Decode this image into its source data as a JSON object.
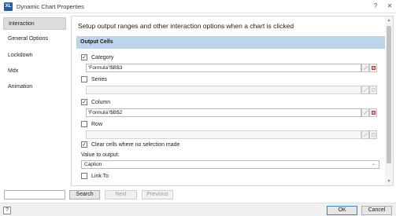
{
  "window": {
    "app_icon_text": "XL",
    "title": "Dynamic Chart Properties",
    "help_glyph": "?",
    "close_glyph": "✕"
  },
  "sidebar": {
    "items": [
      {
        "label": "Interaction",
        "active": true
      },
      {
        "label": "General Options",
        "active": false
      },
      {
        "label": "Lockdown",
        "active": false
      },
      {
        "label": "Mdx",
        "active": false
      },
      {
        "label": "Animation",
        "active": false
      }
    ]
  },
  "main": {
    "heading": "Setup output ranges and other interaction options when a chart is clicked",
    "section_title": "Output Cells",
    "category": {
      "label": "Category",
      "checked": true,
      "value": "'Formula'!$B$3"
    },
    "series": {
      "label": "Series",
      "checked": false,
      "value": ""
    },
    "column": {
      "label": "Column",
      "checked": true,
      "value": "'Formula'!$B$2"
    },
    "row": {
      "label": "Row",
      "checked": false,
      "value": ""
    },
    "clear_cells": {
      "label": "Clear cells where no selection made",
      "checked": true
    },
    "value_to_output_label": "Value to output:",
    "value_to_output": "Caption",
    "link_to": {
      "label": "Link To",
      "checked": false
    }
  },
  "search": {
    "placeholder": "",
    "search_label": "Search",
    "next_label": "Next",
    "previous_label": "Previous"
  },
  "footer": {
    "help_label": "?",
    "ok_label": "OK",
    "cancel_label": "Cancel"
  }
}
